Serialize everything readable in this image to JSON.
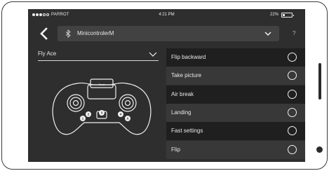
{
  "status_bar": {
    "carrier": "PARROT",
    "time": "4:21 PM",
    "battery": "22%",
    "battery_level": 0.22,
    "signal_bars_filled": 3,
    "signal_bars_total": 5
  },
  "header": {
    "device_name": "MinicontrolerM",
    "help_label": "?"
  },
  "profile": {
    "selected": "Fly Ace"
  },
  "controller": {
    "brand": "Parrot",
    "button_labels": [
      "1",
      "2",
      "3",
      "4",
      "A"
    ]
  },
  "actions": [
    {
      "label": "Flip backward"
    },
    {
      "label": "Take picture"
    },
    {
      "label": "Air break"
    },
    {
      "label": "Landing"
    },
    {
      "label": "Fast settings"
    },
    {
      "label": "Flip"
    }
  ],
  "colors": {
    "background": "#2e2e2e",
    "row_dark": "#1f1f1f",
    "row_light": "#383838",
    "text": "#e8e8e8"
  }
}
